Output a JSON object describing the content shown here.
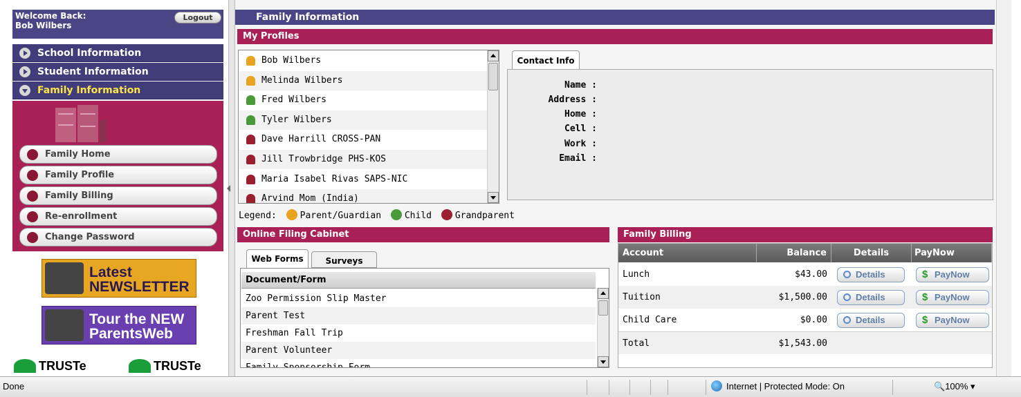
{
  "welcome": {
    "label": "Welcome Back:",
    "user": "Bob Wilbers",
    "logout_label": "Logout"
  },
  "nav": {
    "sections": [
      {
        "label": "School Information"
      },
      {
        "label": "Student Information"
      },
      {
        "label": "Family Information"
      }
    ],
    "family_items": [
      {
        "label": "Family Home"
      },
      {
        "label": "Family Profile"
      },
      {
        "label": "Family Billing"
      },
      {
        "label": "Re-enrollment"
      },
      {
        "label": "Change Password"
      }
    ]
  },
  "banners": {
    "newsletter": [
      "Latest",
      "NEWSLETTER"
    ],
    "tour": [
      "Tour the NEW",
      "ParentsWeb"
    ],
    "truste": "TRUSTe"
  },
  "main": {
    "title": "Family Information"
  },
  "profiles": {
    "header": "My Profiles",
    "items": [
      {
        "name": "Bob Wilbers",
        "type": "parent"
      },
      {
        "name": "Melinda Wilbers",
        "type": "parent"
      },
      {
        "name": "Fred Wilbers",
        "type": "child"
      },
      {
        "name": "Tyler Wilbers",
        "type": "child"
      },
      {
        "name": "Dave Harrill CROSS-PAN",
        "type": "grandparent"
      },
      {
        "name": "Jill Trowbridge PHS-KOS",
        "type": "grandparent"
      },
      {
        "name": "Maria Isabel Rivas SAPS-NIC",
        "type": "grandparent"
      },
      {
        "name": "Arvind Mom (India)",
        "type": "grandparent"
      }
    ],
    "legend": {
      "label": "Legend:",
      "parent": "Parent/Guardian",
      "child": "Child",
      "grandparent": "Grandparent"
    },
    "colors": {
      "parent": "#e8a320",
      "child": "#4a9a3a",
      "grandparent": "#9a2030"
    }
  },
  "contact": {
    "tab_label": "Contact Info",
    "fields": [
      "Name :",
      "Address :",
      "Home :",
      "Cell :",
      "Work :",
      "Email :"
    ]
  },
  "filing": {
    "header": "Online Filing Cabinet",
    "tabs": [
      "Web Forms",
      "Surveys"
    ],
    "column": "Document/Form",
    "rows": [
      "Zoo Permission Slip Master",
      "Parent Test",
      "Freshman Fall Trip",
      "Parent Volunteer",
      "Family Sponsorship Form"
    ]
  },
  "billing": {
    "header": "Family Billing",
    "columns": {
      "account": "Account",
      "balance": "Balance",
      "details": "Details",
      "paynow": "PayNow"
    },
    "rows": [
      {
        "account": "Lunch",
        "balance": "$43.00",
        "details": "Details",
        "paynow": "PayNow"
      },
      {
        "account": "Tuition",
        "balance": "$1,500.00",
        "details": "Details",
        "paynow": "PayNow"
      },
      {
        "account": "Child Care",
        "balance": "$0.00",
        "details": "Details",
        "paynow": "PayNow"
      }
    ],
    "total_label": "Total",
    "total_value": "$1,543.00"
  },
  "status": {
    "text": "Done",
    "zone": "Internet | Protected Mode: On",
    "zoom": "100%"
  }
}
